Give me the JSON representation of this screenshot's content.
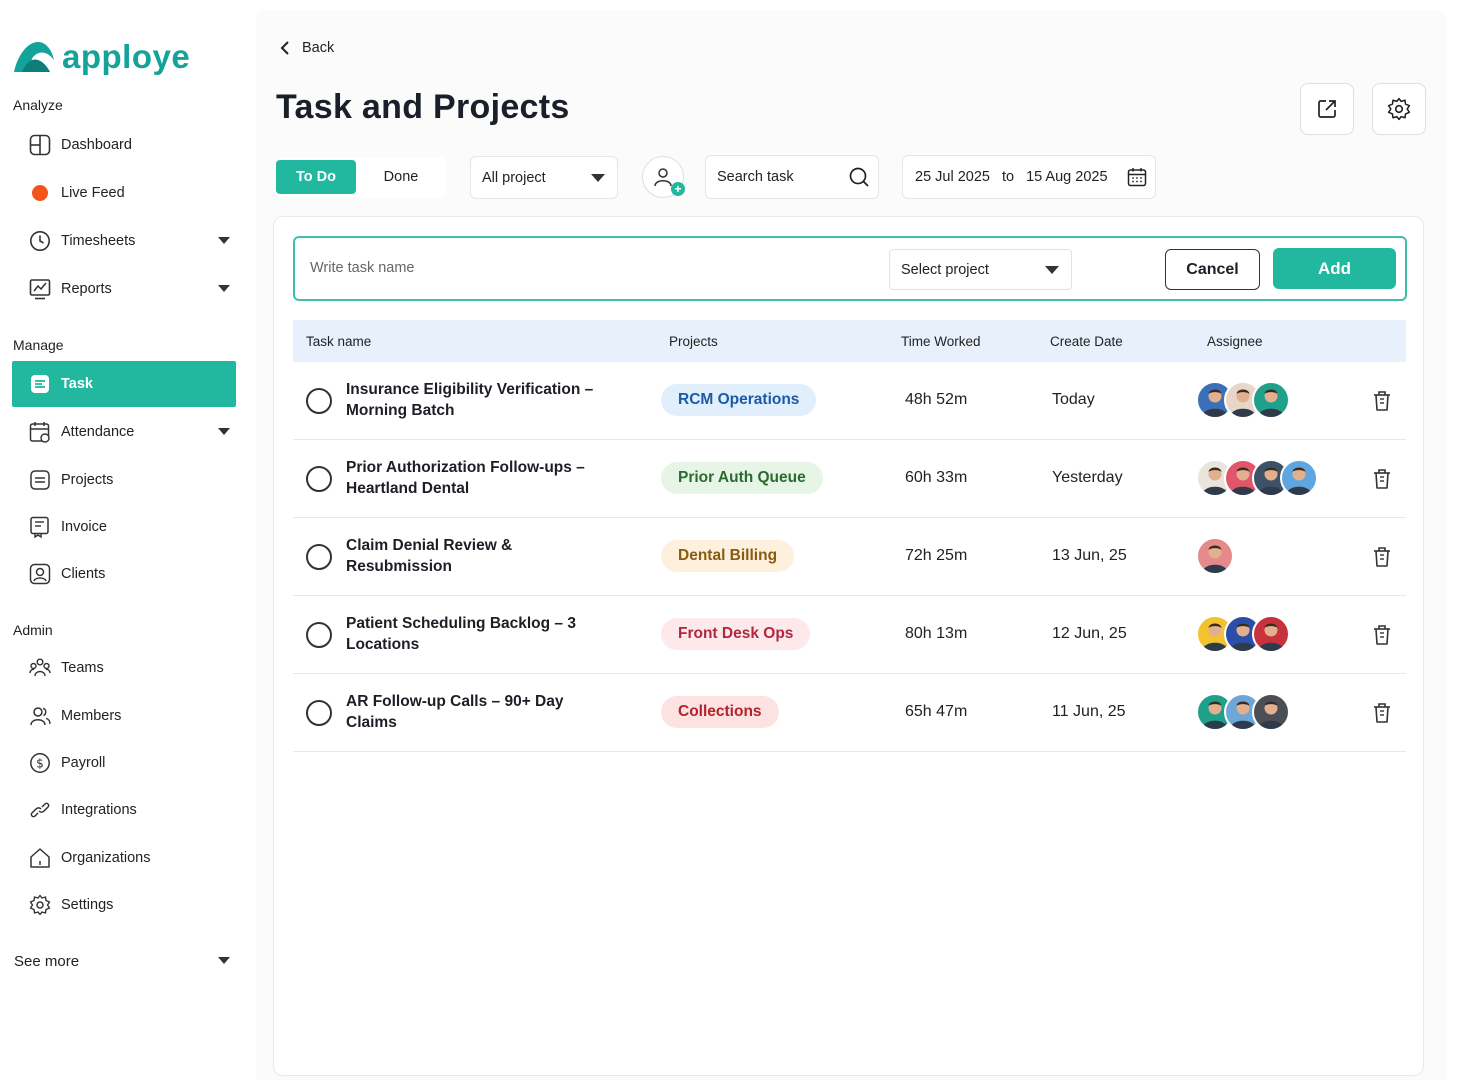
{
  "brand": {
    "name": "apploye",
    "color": "#14a39a",
    "accent": "#22b89f"
  },
  "sidebar": {
    "sections": {
      "analyze": "Analyze",
      "manage": "Manage",
      "admin": "Admin"
    },
    "items": [
      {
        "label": "Dashboard",
        "icon": "dashboard-icon"
      },
      {
        "label": "Live Feed",
        "icon": "live-dot-icon"
      },
      {
        "label": "Timesheets",
        "icon": "clock-icon"
      },
      {
        "label": "Reports",
        "icon": "chart-icon"
      },
      {
        "label": "Task",
        "icon": "task-icon",
        "active": true
      },
      {
        "label": "Attendance",
        "icon": "calendar-icon"
      },
      {
        "label": "Projects",
        "icon": "projects-icon"
      },
      {
        "label": "Invoice",
        "icon": "invoice-icon"
      },
      {
        "label": "Clients",
        "icon": "clients-icon"
      },
      {
        "label": "Teams",
        "icon": "teams-icon"
      },
      {
        "label": "Members",
        "icon": "members-icon"
      },
      {
        "label": "Payroll",
        "icon": "payroll-icon"
      },
      {
        "label": "Integrations",
        "icon": "link-icon"
      },
      {
        "label": "Organizations",
        "icon": "home-icon"
      },
      {
        "label": "Settings",
        "icon": "gear-icon"
      }
    ],
    "see_more": "See more"
  },
  "header": {
    "back": "Back",
    "title": "Task and Projects"
  },
  "filters": {
    "tabs": {
      "todo": "To Do",
      "done": "Done"
    },
    "project_dropdown": "All project",
    "search_placeholder": "Search task",
    "date_from": "25 Jul 2025",
    "date_to_label": "to",
    "date_to": "15 Aug 2025"
  },
  "add_task": {
    "input_placeholder": "Write task name",
    "project_select": "Select project",
    "cancel": "Cancel",
    "add": "Add"
  },
  "table": {
    "columns": [
      "Task name",
      "Projects",
      "Time Worked",
      "Create Date",
      "Assignee"
    ],
    "rows": [
      {
        "task": "Insurance Eligibility Verification – Morning Batch",
        "project": "RCM Operations",
        "pill_bg": "#e1effc",
        "pill_fg": "#1c5aa6",
        "time": "48h 52m",
        "date": "Today",
        "avatars": [
          "#3b6fb8",
          "#e8d7c8",
          "#1ea08a"
        ]
      },
      {
        "task": "Prior Authorization Follow-ups – Heartland Dental",
        "project": "Prior Auth Queue",
        "pill_bg": "#e6f5e6",
        "pill_fg": "#2b6b2f",
        "time": "60h 33m",
        "date": "Yesterday",
        "avatars": [
          "#e9e4dc",
          "#e0566a",
          "#3d5269",
          "#5fa5e0"
        ]
      },
      {
        "task": "Claim Denial Review & Resubmission",
        "project": "Dental Billing",
        "pill_bg": "#fdf0dc",
        "pill_fg": "#8a5a10",
        "time": "72h 25m",
        "date": "13 Jun, 25",
        "avatars": [
          "#e58a8a"
        ]
      },
      {
        "task": "Patient Scheduling Backlog – 3 Locations",
        "project": "Front Desk Ops",
        "pill_bg": "#fde8ec",
        "pill_fg": "#b0283f",
        "time": "80h 13m",
        "date": "12 Jun, 25",
        "avatars": [
          "#f2c230",
          "#2b4fa8",
          "#c8323c"
        ]
      },
      {
        "task": "AR Follow-up Calls – 90+ Day Claims",
        "project": "Collections",
        "pill_bg": "#fde2e2",
        "pill_fg": "#b0242c",
        "time": "65h 47m",
        "date": "11 Jun, 25",
        "avatars": [
          "#1ea08a",
          "#6fa6d8",
          "#4a4f57"
        ]
      }
    ]
  }
}
